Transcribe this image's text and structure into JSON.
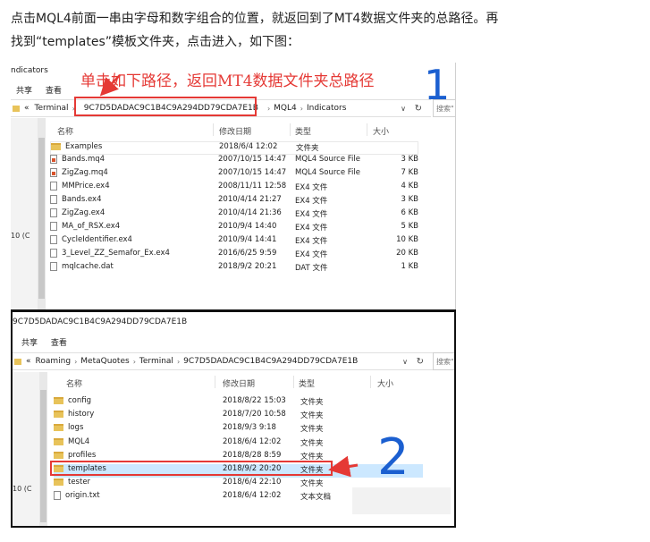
{
  "article": {
    "line1": "点击MQL4前面一串由字母和数字组合的位置，就返回到了MT4数据文件夹的总路径。再",
    "line2": "找到“templates”模板文件夹，点击进入，如下图："
  },
  "shot1": {
    "window_title": "ndicators",
    "ribbon": [
      "共享",
      "查看"
    ],
    "address": {
      "prefix": "«",
      "segments": [
        "Terminal",
        "9C7D5DADAC9C1B4C9A294DD79CDA7E1B",
        "MQL4",
        "Indicators"
      ]
    },
    "search_placeholder": "搜索\"",
    "annotation": "单击如下路径，返回MT4数据文件夹总路径",
    "step_number": "1",
    "columns": {
      "name": "名称",
      "date": "修改日期",
      "type": "类型",
      "size": "大小"
    },
    "nav_label": "10 (C",
    "files": [
      {
        "icon": "folder-icon",
        "name": "Examples",
        "date": "2018/6/4 12:02",
        "type": "文件夹",
        "size": ""
      },
      {
        "icon": "mq4-file-icon",
        "name": "Bands.mq4",
        "date": "2007/10/15 14:47",
        "type": "MQL4 Source File",
        "size": "3 KB"
      },
      {
        "icon": "mq4-file-icon",
        "name": "ZigZag.mq4",
        "date": "2007/10/15 14:47",
        "type": "MQL4 Source File",
        "size": "7 KB"
      },
      {
        "icon": "ex4-file-icon",
        "name": "MMPrice.ex4",
        "date": "2008/11/11 12:58",
        "type": "EX4 文件",
        "size": "4 KB"
      },
      {
        "icon": "ex4-file-icon",
        "name": "Bands.ex4",
        "date": "2010/4/14 21:27",
        "type": "EX4 文件",
        "size": "3 KB"
      },
      {
        "icon": "ex4-file-icon",
        "name": "ZigZag.ex4",
        "date": "2010/4/14 21:36",
        "type": "EX4 文件",
        "size": "6 KB"
      },
      {
        "icon": "ex4-file-icon",
        "name": "MA_of_RSX.ex4",
        "date": "2010/9/4 14:40",
        "type": "EX4 文件",
        "size": "5 KB"
      },
      {
        "icon": "ex4-file-icon",
        "name": "CycleIdentifier.ex4",
        "date": "2010/9/4 14:41",
        "type": "EX4 文件",
        "size": "10 KB"
      },
      {
        "icon": "ex4-file-icon",
        "name": "3_Level_ZZ_Semafor_Ex.ex4",
        "date": "2016/6/25 9:59",
        "type": "EX4 文件",
        "size": "20 KB"
      },
      {
        "icon": "dat-file-icon",
        "name": "mqlcache.dat",
        "date": "2018/9/2 20:21",
        "type": "DAT 文件",
        "size": "1 KB"
      }
    ]
  },
  "shot2": {
    "window_title": "9C7D5DADAC9C1B4C9A294DD79CDA7E1B",
    "ribbon": [
      "共享",
      "查看"
    ],
    "address": {
      "prefix": "«",
      "segments": [
        "Roaming",
        "MetaQuotes",
        "Terminal",
        "9C7D5DADAC9C1B4C9A294DD79CDA7E1B"
      ]
    },
    "search_placeholder": "搜索\"",
    "step_number": "2",
    "columns": {
      "name": "名称",
      "date": "修改日期",
      "type": "类型",
      "size": "大小"
    },
    "nav_label": "10 (C",
    "files": [
      {
        "icon": "folder-icon",
        "name": "config",
        "date": "2018/8/22 15:03",
        "type": "文件夹"
      },
      {
        "icon": "folder-icon",
        "name": "history",
        "date": "2018/7/20 10:58",
        "type": "文件夹"
      },
      {
        "icon": "folder-icon",
        "name": "logs",
        "date": "2018/9/3 9:18",
        "type": "文件夹"
      },
      {
        "icon": "folder-icon",
        "name": "MQL4",
        "date": "2018/6/4 12:02",
        "type": "文件夹"
      },
      {
        "icon": "folder-icon",
        "name": "profiles",
        "date": "2018/8/28 8:59",
        "type": "文件夹"
      },
      {
        "icon": "folder-icon",
        "name": "templates",
        "date": "2018/9/2 20:20",
        "type": "文件夹"
      },
      {
        "icon": "folder-icon",
        "name": "tester",
        "date": "2018/6/4 22:10",
        "type": "文件夹"
      },
      {
        "icon": "txt-file-icon",
        "name": "origin.txt",
        "date": "2018/6/4 12:02",
        "type": "文本文档"
      }
    ]
  },
  "colors": {
    "annotation_red": "#e53935",
    "step_number_blue": "#1b5fd0",
    "selection_blue": "#cce8ff",
    "folder_yellow": "#e8c35a"
  }
}
